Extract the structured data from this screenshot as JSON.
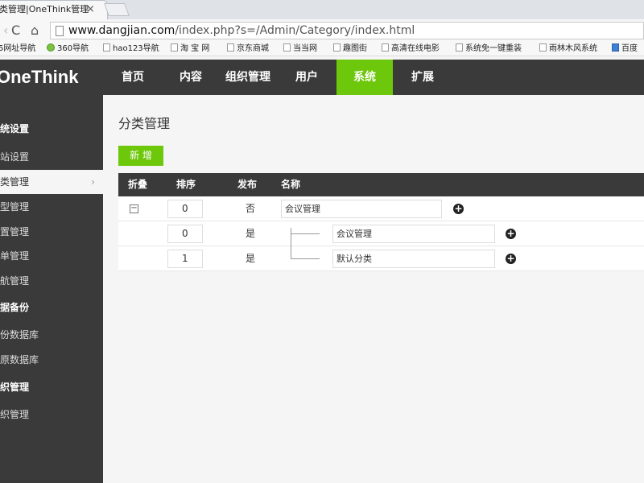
{
  "browser": {
    "tab_title": "类管理|OneThink管理",
    "tab_close": "×",
    "back": "‹",
    "forward": "›",
    "reload": "C",
    "home": "⌂",
    "url_host": "www.dangjian.com",
    "url_path": "/index.php?s=/Admin/Category/index.html",
    "bookmarks": [
      "5网址导航",
      "360导航",
      "hao123导航",
      "淘 宝 网",
      "京东商城",
      "当当网",
      "趣图街",
      "高清在线电影",
      "系统免一键重装",
      "雨林木风系统",
      "百度"
    ]
  },
  "header": {
    "logo": "OneThink",
    "nav": [
      "首页",
      "内容",
      "组织管理",
      "用户",
      "系统",
      "扩展"
    ],
    "active_nav": "系统",
    "accent_color": "#6dc70a"
  },
  "sidebar": {
    "items": [
      {
        "label": "统设置",
        "group": true
      },
      {
        "label": "站设置",
        "group": false
      },
      {
        "label": "类管理",
        "group": false,
        "active": true,
        "chevron": "›"
      },
      {
        "label": "型管理",
        "group": false
      },
      {
        "label": "置管理",
        "group": false
      },
      {
        "label": "单管理",
        "group": false
      },
      {
        "label": "航管理",
        "group": false
      },
      {
        "label": "据备份",
        "group": true
      },
      {
        "label": "份数据库",
        "group": false
      },
      {
        "label": "原数据库",
        "group": false
      },
      {
        "label": "织管理",
        "group": true
      },
      {
        "label": "织管理",
        "group": false
      }
    ]
  },
  "main": {
    "title": "分类管理",
    "add_button": "新 增",
    "columns": [
      "折叠",
      "排序",
      "发布",
      "名称"
    ],
    "rows": [
      {
        "sort": "0",
        "publish": "否",
        "name": "会议管理",
        "level": 0,
        "fold": "−",
        "add_icon": "+"
      },
      {
        "sort": "0",
        "publish": "是",
        "name": "会议管理",
        "level": 1,
        "add_icon": "+"
      },
      {
        "sort": "1",
        "publish": "是",
        "name": "默认分类",
        "level": 1,
        "add_icon": "+"
      }
    ]
  }
}
